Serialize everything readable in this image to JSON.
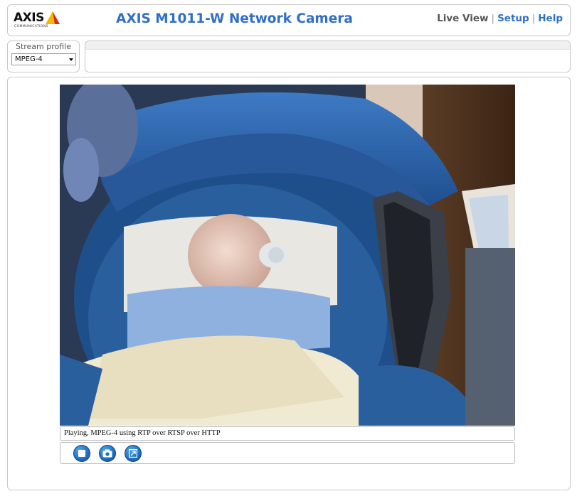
{
  "header": {
    "logo_text": "AXIS",
    "logo_tagline": "COMMUNICATIONS",
    "title": "AXIS M1011-W Network Camera",
    "nav": [
      {
        "label": "Live View",
        "active": true
      },
      {
        "label": "Setup",
        "active": false
      },
      {
        "label": "Help",
        "active": false
      }
    ],
    "nav_separator": "|"
  },
  "stream_profile": {
    "label": "Stream profile",
    "selected": "MPEG-4"
  },
  "video": {
    "status_text": "Playing, MPEG-4 using RTP over RTSP over HTTP"
  },
  "controls": [
    {
      "icon": "stop-icon"
    },
    {
      "icon": "snapshot-camera-icon"
    },
    {
      "icon": "fullscreen-icon"
    }
  ],
  "colors": {
    "accent": "#2f6fc8",
    "nav_active": "#555555",
    "logo_yellow": "#f5b700",
    "logo_red": "#d52b1e",
    "control_blue": "#1f6ec2"
  }
}
